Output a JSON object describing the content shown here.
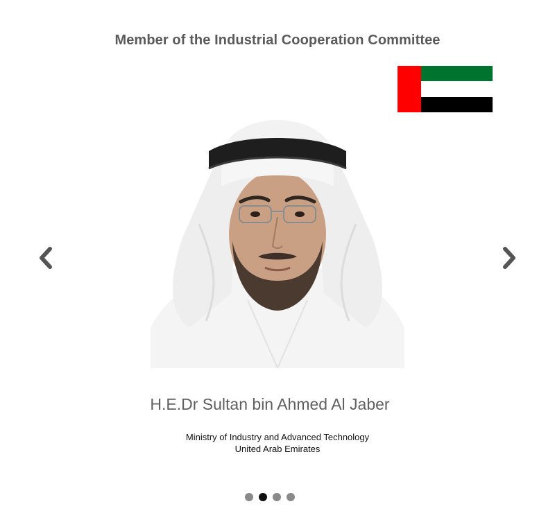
{
  "heading": "Member of the Industrial Cooperation Committee",
  "flag": {
    "icon": "uae-flag",
    "colors": {
      "red": "#ff0000",
      "green": "#00732f",
      "white": "#ffffff",
      "black": "#000000"
    }
  },
  "slide": {
    "name": "H.E.Dr Sultan bin Ahmed Al Jaber",
    "ministry": "Ministry of Industry and Advanced Technology",
    "country": "United Arab Emirates",
    "photo_icon": "portrait-photo"
  },
  "navigation": {
    "prev_icon": "chevron-left-icon",
    "next_icon": "chevron-right-icon",
    "arrow_color": "#555555"
  },
  "pagination": {
    "total": 4,
    "active_index": 1,
    "active_color": "#111111",
    "inactive_color": "#8a8a8a"
  }
}
